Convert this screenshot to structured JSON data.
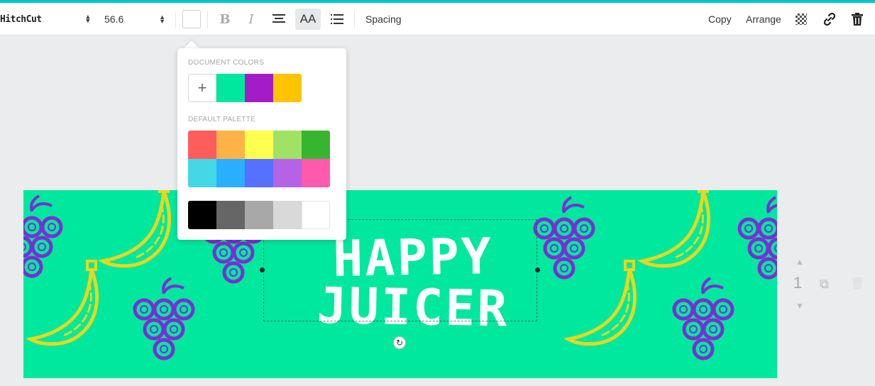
{
  "toolbar": {
    "font_name": "HitchCut",
    "font_size": "56.6",
    "bold_label": "B",
    "italic_label": "I",
    "uppercase_label": "AA",
    "spacing_label": "Spacing",
    "copy_label": "Copy",
    "arrange_label": "Arrange",
    "accent_color": "#00c4cc"
  },
  "color_popup": {
    "document_colors_label": "DOCUMENT COLORS",
    "add_label": "+",
    "document_colors": [
      "#00e89e",
      "#a41cc8",
      "#ffc400"
    ],
    "default_palette_label": "DEFAULT PALETTE",
    "palette_row1": [
      "#ff5c5c",
      "#ffb347",
      "#ffff50",
      "#a0e266",
      "#38b52f"
    ],
    "palette_row2": [
      "#44d7e6",
      "#2aaeff",
      "#5671ff",
      "#b563e6",
      "#ff5aad"
    ],
    "grayscale": [
      "#000000",
      "#666666",
      "#a8a8a8",
      "#d9d9d9",
      "#ffffff"
    ]
  },
  "canvas": {
    "background": "#00e89e",
    "title_line1": "HAPPY",
    "title_line2": "JUICER",
    "grape_color": "#7a2fd4",
    "banana_color": "#e6d81e"
  },
  "page": {
    "number": "1"
  }
}
